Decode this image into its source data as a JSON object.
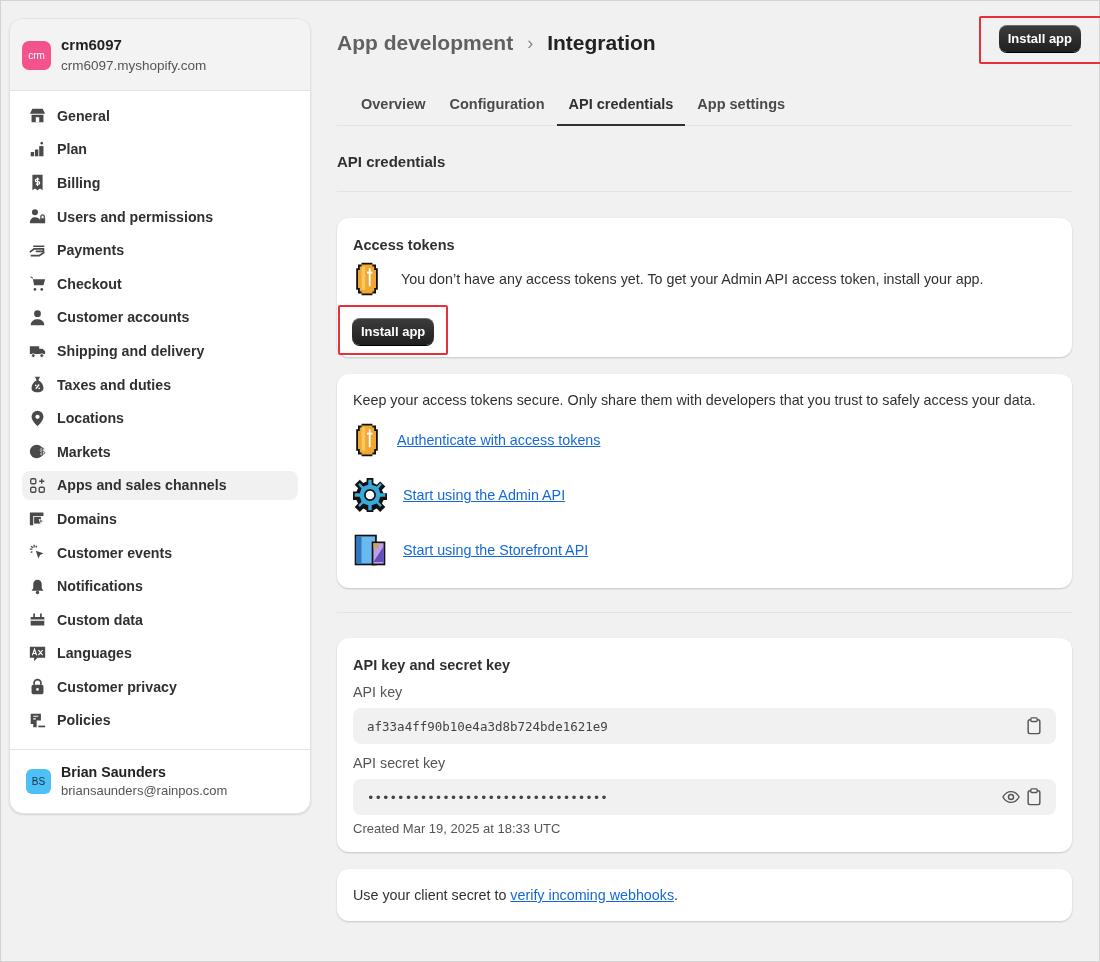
{
  "store": {
    "avatar": "crm",
    "name": "crm6097",
    "domain": "crm6097.myshopify.com"
  },
  "sidebar": {
    "items": [
      {
        "label": "General",
        "selected": false
      },
      {
        "label": "Plan",
        "selected": false
      },
      {
        "label": "Billing",
        "selected": false
      },
      {
        "label": "Users and permissions",
        "selected": false
      },
      {
        "label": "Payments",
        "selected": false
      },
      {
        "label": "Checkout",
        "selected": false
      },
      {
        "label": "Customer accounts",
        "selected": false
      },
      {
        "label": "Shipping and delivery",
        "selected": false
      },
      {
        "label": "Taxes and duties",
        "selected": false
      },
      {
        "label": "Locations",
        "selected": false
      },
      {
        "label": "Markets",
        "selected": false
      },
      {
        "label": "Apps and sales channels",
        "selected": true
      },
      {
        "label": "Domains",
        "selected": false
      },
      {
        "label": "Customer events",
        "selected": false
      },
      {
        "label": "Notifications",
        "selected": false
      },
      {
        "label": "Custom data",
        "selected": false
      },
      {
        "label": "Languages",
        "selected": false
      },
      {
        "label": "Customer privacy",
        "selected": false
      },
      {
        "label": "Policies",
        "selected": false
      }
    ]
  },
  "user": {
    "initials": "BS",
    "name": "Brian Saunders",
    "email": "briansaunders@rainpos.com"
  },
  "breadcrumb": {
    "parent": "App development",
    "separator": "›",
    "current": "Integration"
  },
  "header_button": {
    "label": "Install app",
    "highlighted": true
  },
  "tabs": [
    {
      "label": "Overview",
      "selected": false
    },
    {
      "label": "Configuration",
      "selected": false
    },
    {
      "label": "API credentials",
      "selected": true
    },
    {
      "label": "App settings",
      "selected": false
    }
  ],
  "section_title": "API credentials",
  "access_tokens": {
    "title": "Access tokens",
    "message": "You don’t have any access tokens yet. To get your Admin API access token, install your app.",
    "button": {
      "label": "Install app",
      "highlighted": true
    }
  },
  "security": {
    "intro": "Keep your access tokens secure. Only share them with developers that you trust to safely access your data.",
    "links": [
      {
        "kind": "coin",
        "label": "Authenticate with access tokens"
      },
      {
        "kind": "gear",
        "label": "Start using the Admin API"
      },
      {
        "kind": "blueprint",
        "label": "Start using the Storefront API"
      }
    ]
  },
  "keys": {
    "title": "API key and secret key",
    "fields": [
      {
        "label": "API key",
        "value": "af33a4ff90b10e4a3d8b724bde1621e9",
        "masked": false
      },
      {
        "label": "API secret key",
        "value": "••••••••••••••••••••••••••••••••",
        "masked": true
      }
    ],
    "created": "Created Mar 19, 2025 at 18:33 UTC"
  },
  "webhooks": {
    "before": "Use your client secret to ",
    "link": "verify incoming webhooks",
    "after": "."
  }
}
